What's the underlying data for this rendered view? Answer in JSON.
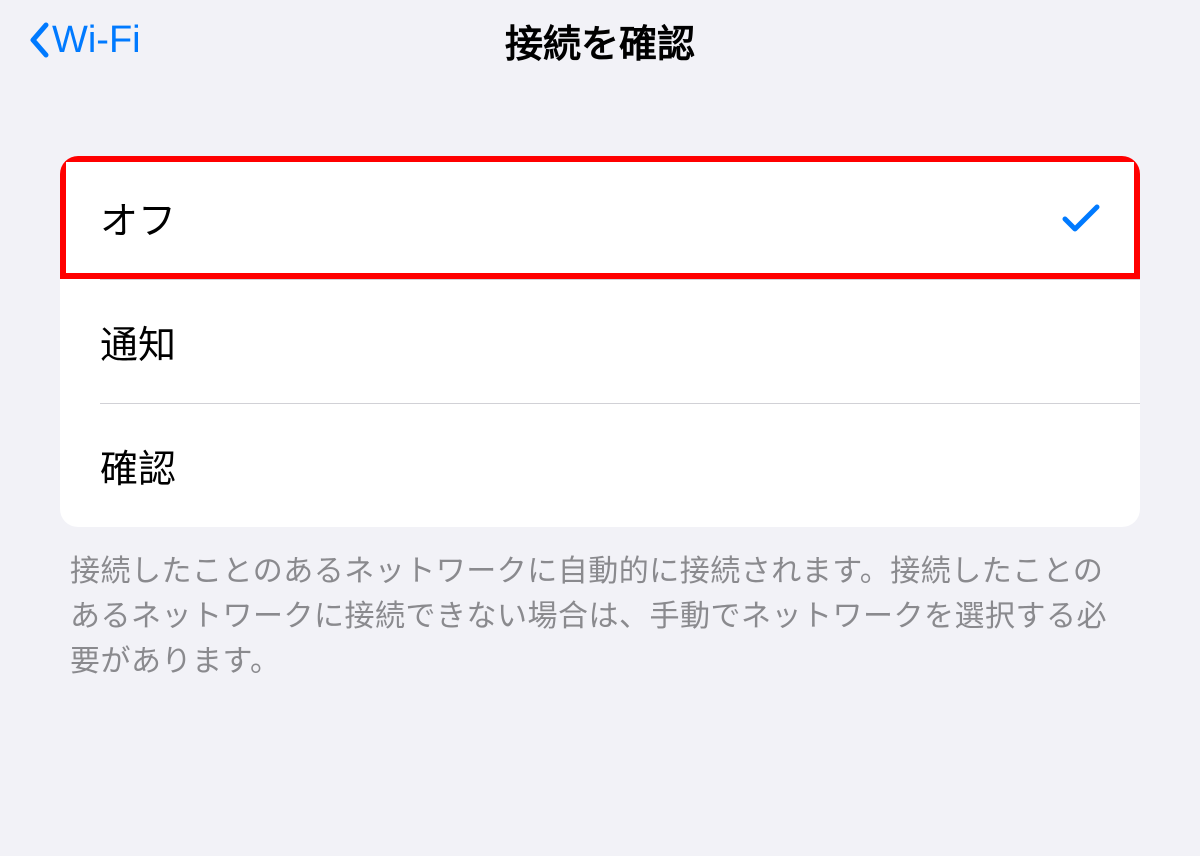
{
  "header": {
    "back_label": "Wi-Fi",
    "title": "接続を確認"
  },
  "options": [
    {
      "label": "オフ",
      "selected": true,
      "highlighted": true
    },
    {
      "label": "通知",
      "selected": false,
      "highlighted": false
    },
    {
      "label": "確認",
      "selected": false,
      "highlighted": false
    }
  ],
  "footer": {
    "text": "接続したことのあるネットワークに自動的に接続されます。接続したことのあるネットワークに接続できない場合は、手動でネットワークを選択する必要があります。"
  },
  "colors": {
    "accent": "#007aff",
    "highlight_border": "#ff0000"
  }
}
